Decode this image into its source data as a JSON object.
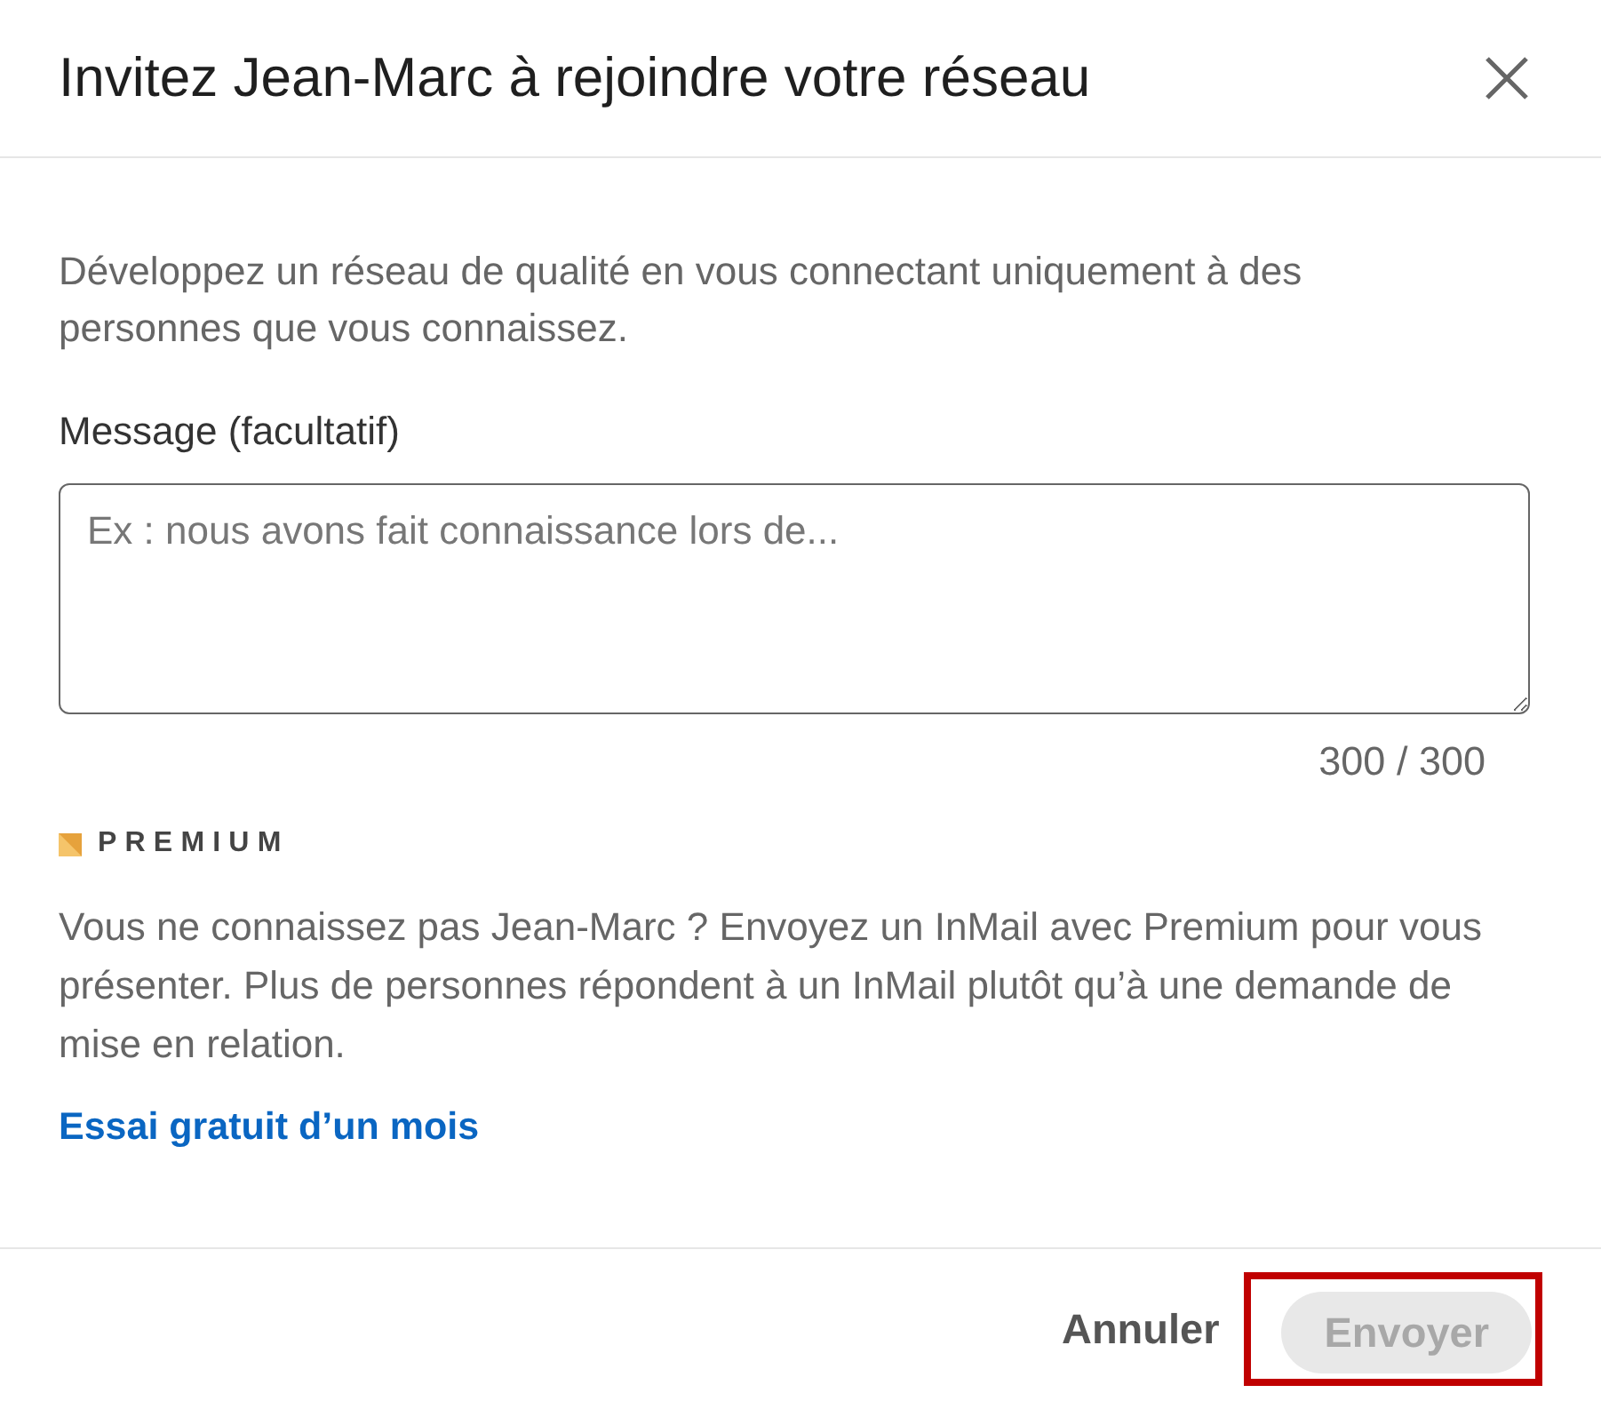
{
  "dialog": {
    "title": "Invitez Jean-Marc à rejoindre votre réseau"
  },
  "intro": "Développez un réseau de qualité en vous connectant uniquement à des personnes que vous connaissez.",
  "message": {
    "label": "Message (facultatif)",
    "placeholder": "Ex : nous avons fait connaissance lors de...",
    "counter": "300 / 300"
  },
  "premium": {
    "badge": "PREMIUM",
    "text": "Vous ne connaissez pas Jean-Marc ? Envoyez un InMail avec Premium pour vous présenter. Plus de personnes répondent à un InMail plutôt qu’à une demande de mise en relation.",
    "link": "Essai gratuit d’un mois"
  },
  "footer": {
    "buttons": [
      {
        "label": "Annuler",
        "kind": "text",
        "disabled": false,
        "highlighted": false
      },
      {
        "label": "Envoyer",
        "kind": "pill",
        "disabled": true,
        "highlighted": true
      }
    ]
  }
}
